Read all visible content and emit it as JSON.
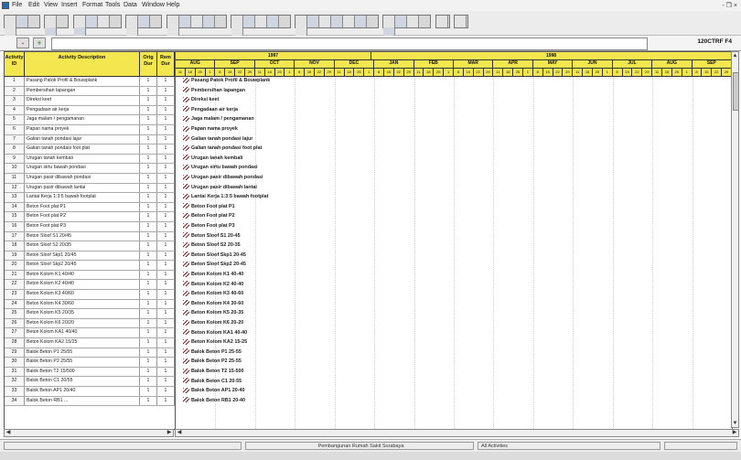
{
  "menu": [
    "File",
    "Edit",
    "View",
    "Insert",
    "Format",
    "Tools",
    "Data",
    "Window",
    "Help"
  ],
  "window_controls": "- ❐ ×",
  "editbar": {
    "cancel_label": "-",
    "accept_label": "+",
    "project_code": "120CTRF F4"
  },
  "table": {
    "headers": {
      "id": "Activity ID",
      "desc": "Activity Description",
      "orig_dur": "Orig Dur",
      "rem_dur": "Rem Dur"
    },
    "rows": [
      {
        "id": "1",
        "desc": "Pasang Patok Profil & Bouwplank",
        "od": "1",
        "rd": "1"
      },
      {
        "id": "2",
        "desc": "Pembersihan lapangan",
        "od": "1",
        "rd": "1"
      },
      {
        "id": "3",
        "desc": "Direksi keet",
        "od": "1",
        "rd": "1"
      },
      {
        "id": "4",
        "desc": "Pengadaan air kerja",
        "od": "1",
        "rd": "1"
      },
      {
        "id": "5",
        "desc": "Jaga malam / pengamanan",
        "od": "1",
        "rd": "1"
      },
      {
        "id": "6",
        "desc": "Papan nama proyek",
        "od": "1",
        "rd": "1"
      },
      {
        "id": "7",
        "desc": "Galian tanah pondasi lajur",
        "od": "1",
        "rd": "1"
      },
      {
        "id": "8",
        "desc": "Galian tanah pondasi foot plat",
        "od": "1",
        "rd": "1"
      },
      {
        "id": "9",
        "desc": "Urugan tanah kembali",
        "od": "1",
        "rd": "1"
      },
      {
        "id": "10",
        "desc": "Urugan sirtu bawah pondasi",
        "od": "1",
        "rd": "1"
      },
      {
        "id": "11",
        "desc": "Urugan pasir dibawah pondasi",
        "od": "1",
        "rd": "1"
      },
      {
        "id": "12",
        "desc": "Urugan pasir dibawah lantai",
        "od": "1",
        "rd": "1"
      },
      {
        "id": "13",
        "desc": "Lantai Kerja 1:3:5 bawah footplat",
        "od": "1",
        "rd": "1"
      },
      {
        "id": "14",
        "desc": "Beton Foot plat P1",
        "od": "1",
        "rd": "1"
      },
      {
        "id": "15",
        "desc": "Beton Foot plat P2",
        "od": "1",
        "rd": "1"
      },
      {
        "id": "16",
        "desc": "Beton Foot plat P3",
        "od": "1",
        "rd": "1"
      },
      {
        "id": "17",
        "desc": "Beton Sloof S1 20/45",
        "od": "1",
        "rd": "1"
      },
      {
        "id": "18",
        "desc": "Beton Sloof S2 20/35",
        "od": "1",
        "rd": "1"
      },
      {
        "id": "19",
        "desc": "Beton Sloof Skp1 20/45",
        "od": "1",
        "rd": "1"
      },
      {
        "id": "20",
        "desc": "Beton Sloof Skp2 20/45",
        "od": "1",
        "rd": "1"
      },
      {
        "id": "21",
        "desc": "Beton Kolom K1 40/40",
        "od": "1",
        "rd": "1"
      },
      {
        "id": "22",
        "desc": "Beton Kolom K2 40/40",
        "od": "1",
        "rd": "1"
      },
      {
        "id": "23",
        "desc": "Beton Kolom K3 40/60",
        "od": "1",
        "rd": "1"
      },
      {
        "id": "24",
        "desc": "Beton Kolom K4 30/60",
        "od": "1",
        "rd": "1"
      },
      {
        "id": "25",
        "desc": "Beton Kolom K5 20/35",
        "od": "1",
        "rd": "1"
      },
      {
        "id": "26",
        "desc": "Beton Kolom K6 20/20",
        "od": "1",
        "rd": "1"
      },
      {
        "id": "27",
        "desc": "Beton Kolom KA1 40/40",
        "od": "1",
        "rd": "1"
      },
      {
        "id": "28",
        "desc": "Beton Kolom KA2 15/25",
        "od": "1",
        "rd": "1"
      },
      {
        "id": "29",
        "desc": "Balok Beton P1 25/55",
        "od": "1",
        "rd": "1"
      },
      {
        "id": "30",
        "desc": "Balok Beton P2 25/55",
        "od": "1",
        "rd": "1"
      },
      {
        "id": "31",
        "desc": "Balok Beton T2 15/500",
        "od": "1",
        "rd": "1"
      },
      {
        "id": "32",
        "desc": "Balok Beton C1 20/55",
        "od": "1",
        "rd": "1"
      },
      {
        "id": "33",
        "desc": "Balok Beton AP1 20/40",
        "od": "1",
        "rd": "1"
      },
      {
        "id": "34",
        "desc": "Balok Beton RB1 ...",
        "od": "1",
        "rd": "1"
      }
    ]
  },
  "timescale": {
    "years": [
      "1997",
      "1998"
    ],
    "months": [
      "AUG",
      "SEP",
      "OCT",
      "NOV",
      "DEC",
      "JAN",
      "FEB",
      "MAR",
      "APR",
      "MAY",
      "JUN",
      "JUL",
      "AUG",
      "SEP"
    ],
    "weeks_pattern": [
      "11",
      "18",
      "25",
      "1",
      "8",
      "15",
      "22",
      "29"
    ]
  },
  "bars": [
    "Pasang Patok Profil & Bouwplank",
    "Pembersihan lapangan",
    "Direksi keet",
    "Pengadaan air kerja",
    "Jaga malam / pengamanan",
    "Papan nama proyek",
    "Galian tanah pondasi lajur",
    "Galian tanah pondasi foot plat",
    "Urugan tanah kembali",
    "Urugan sirtu bawah pondasi",
    "Urugan pasir dibawah pondasi",
    "Urugan pasir dibawah lantai",
    "Lantai Kerja 1:3:5 bawah footplat",
    "Beton Foot plat P1",
    "Beton Foot plat P2",
    "Beton Foot plat P3",
    "Beton Sloof S1 20-45",
    "Beton Sloof S2 20-35",
    "Beton Sloof Skp1 20-45",
    "Beton Sloof Skp2 20-45",
    "Beton Kolom K1 40-40",
    "Beton Kolom K2 40-40",
    "Beton Kolom K3 40-60",
    "Beton Kolom K4 30-60",
    "Beton Kolom K5 20-35",
    "Beton Kolom K6 20-20",
    "Beton Kolom KA1 40-40",
    "Beton Kolom KA2 15-25",
    "Balok Beton P1 25-55",
    "Balok Beton P2 25-55",
    "Balok Beton T2 15-500",
    "Balok Beton C1 20-55",
    "Balok Beton AP1 20-40",
    "Balok Beton RB1 20-40"
  ],
  "status": {
    "project": "Pembangunan Rumah Sakit Surabaya",
    "filter": "All Activities"
  },
  "colors": {
    "header_bg": "#f3e64e",
    "bar_marker": "#7a2020"
  }
}
